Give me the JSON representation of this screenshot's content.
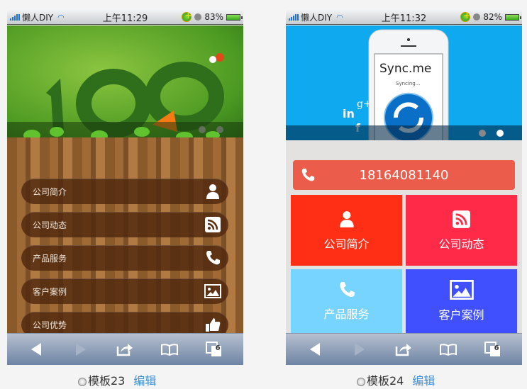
{
  "left": {
    "status": {
      "carrier": "懒人DIY",
      "time": "上午11:29",
      "battery": "83%"
    },
    "menu": [
      {
        "label": "公司简介",
        "icon": "user-icon"
      },
      {
        "label": "公司动态",
        "icon": "rss-icon"
      },
      {
        "label": "产品服务",
        "icon": "phone-icon"
      },
      {
        "label": "客户案例",
        "icon": "image-icon"
      },
      {
        "label": "公司优势",
        "icon": "thumbs-up-icon"
      }
    ],
    "tabs_count": "6",
    "caption": {
      "name": "模板23",
      "edit": "编辑"
    }
  },
  "right": {
    "status": {
      "carrier": "懒人DIY",
      "time": "上午11:32",
      "battery": "82%"
    },
    "hero": {
      "brand": "Sync.me",
      "syncing": "Syncing...",
      "social": [
        "in",
        "g+",
        "f"
      ]
    },
    "phone_number": "18164081140",
    "tiles": [
      {
        "label": "公司简介",
        "icon": "user-icon",
        "color": "#ff2f15"
      },
      {
        "label": "公司动态",
        "icon": "rss-icon",
        "color": "#ff2a47"
      },
      {
        "label": "产品服务",
        "icon": "phone-icon",
        "color": "#77d4ff"
      },
      {
        "label": "客户案例",
        "icon": "image-icon",
        "color": "#4150ff"
      }
    ],
    "tabs_count": "6",
    "caption": {
      "name": "模板24",
      "edit": "编辑"
    }
  }
}
